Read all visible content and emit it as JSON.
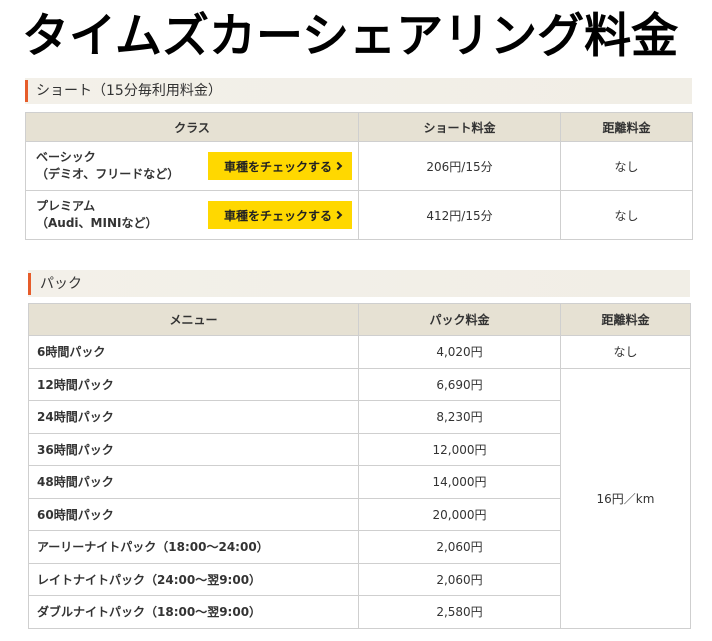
{
  "page_title": "タイムズカーシェアリング料金",
  "colors": {
    "accent_bar": "#e65c2a",
    "button_bg": "#ffd800",
    "table_header_bg": "#e6e1d3",
    "section_head_bg": "#f3f0e9"
  },
  "icons": {
    "check_button": "chevron-right-icon"
  },
  "short_section": {
    "heading": "ショート（15分毎利用料金）",
    "headers": {
      "class": "クラス",
      "price": "ショート料金",
      "distance": "距離料金"
    },
    "rows": [
      {
        "name": "ベーシック",
        "examples": "（デミオ、フリードなど）",
        "button": "車種をチェックする",
        "price": "206円/15分",
        "distance_fee": "なし"
      },
      {
        "name": "プレミアム",
        "examples": "（Audi、MINIなど）",
        "button": "車種をチェックする",
        "price": "412円/15分",
        "distance_fee": "なし"
      }
    ]
  },
  "pack_section": {
    "heading": "パック",
    "headers": {
      "menu": "メニュー",
      "price": "パック料金",
      "distance": "距離料金"
    },
    "rows": [
      {
        "menu": "6時間パック",
        "price": "4,020円"
      },
      {
        "menu": "12時間パック",
        "price": "6,690円"
      },
      {
        "menu": "24時間パック",
        "price": "8,230円"
      },
      {
        "menu": "36時間パック",
        "price": "12,000円"
      },
      {
        "menu": "48時間パック",
        "price": "14,000円"
      },
      {
        "menu": "60時間パック",
        "price": "20,000円"
      },
      {
        "menu": "アーリーナイトパック（18:00～24:00）",
        "price": "2,060円"
      },
      {
        "menu": "レイトナイトパック（24:00～翌9:00）",
        "price": "2,060円"
      },
      {
        "menu": "ダブルナイトパック（18:00～翌9:00）",
        "price": "2,580円"
      }
    ],
    "distance_fee_first": "なし",
    "distance_fee_rest": "16円／km"
  }
}
